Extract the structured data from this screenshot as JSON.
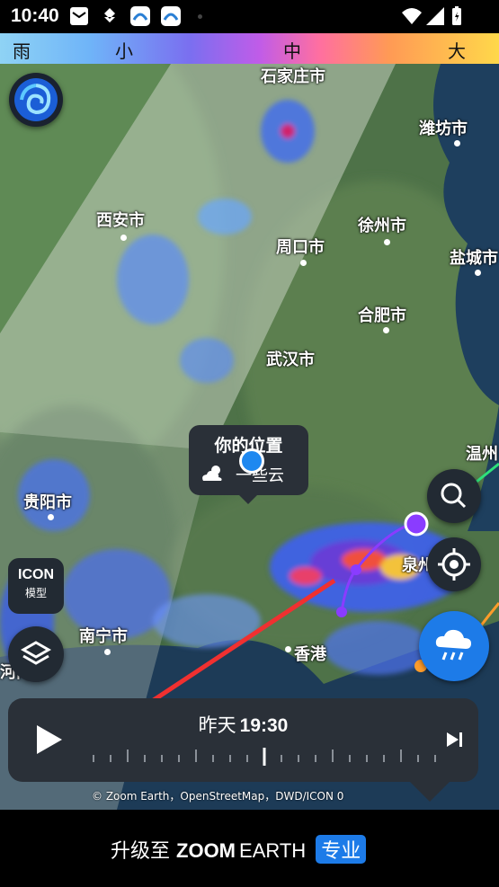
{
  "status_bar": {
    "time": "10:40"
  },
  "legend": {
    "labels": [
      "雨",
      "小",
      "中",
      "大"
    ]
  },
  "map": {
    "cities": [
      "石家庄市",
      "潍坊市",
      "西安市",
      "徐州市",
      "周口市",
      "盐城市",
      "合肥市",
      "武汉市",
      "温州",
      "贵阳市",
      "泉州",
      "南宁市",
      "香港",
      "河内市"
    ],
    "location_bubble": {
      "title": "你的位置",
      "weather": "一些云"
    },
    "model_button": {
      "name": "ICON",
      "caption": "模型"
    },
    "attribution": "© Zoom Earth，OpenStreetMap，DWD/ICON 0"
  },
  "timeline": {
    "day": "昨天",
    "time": "19:30"
  },
  "ad_banner": {
    "prefix": "升级至",
    "brand": "ZOOM",
    "brand_suffix": "EARTH",
    "badge": "专业"
  }
}
